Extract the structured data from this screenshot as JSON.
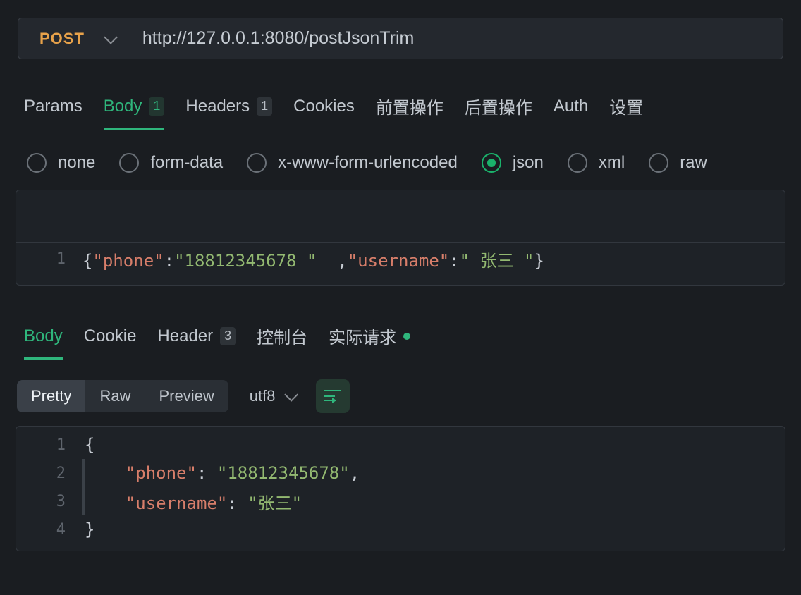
{
  "request": {
    "method": "POST",
    "url": "http://127.0.0.1:8080/postJsonTrim"
  },
  "tabs": {
    "params": "Params",
    "body": "Body",
    "body_count": "1",
    "headers": "Headers",
    "headers_count": "1",
    "cookies": "Cookies",
    "pre": "前置操作",
    "post": "后置操作",
    "auth": "Auth",
    "settings": "设置"
  },
  "body_types": {
    "none": "none",
    "form_data": "form-data",
    "xform": "x-www-form-urlencoded",
    "json": "json",
    "xml": "xml",
    "raw": "raw"
  },
  "request_body": {
    "line_no": "1",
    "tokens": {
      "brace_open": "{",
      "q1": "\"",
      "key1": "phone",
      "q2": "\"",
      "colon1": ":",
      "q3": "\"",
      "val1": "18812345678 ",
      "q4": "\"",
      "sep": "  ,",
      "q5": "\"",
      "key2": "username",
      "q6": "\"",
      "colon2": ":",
      "q7": "\"",
      "val2": " 张三 ",
      "q8": "\"",
      "brace_close": "}"
    }
  },
  "response_tabs": {
    "body": "Body",
    "cookie": "Cookie",
    "header": "Header",
    "header_count": "3",
    "console": "控制台",
    "actual": "实际请求"
  },
  "response_toolbar": {
    "pretty": "Pretty",
    "raw": "Raw",
    "preview": "Preview",
    "encoding": "utf8"
  },
  "response_body": {
    "lines": {
      "l1_no": "1",
      "l1_code_brace": "{",
      "l2_no": "2",
      "l2_indent": "    ",
      "l2_q1": "\"",
      "l2_key": "phone",
      "l2_q2": "\"",
      "l2_colon": ": ",
      "l2_q3": "\"",
      "l2_val": "18812345678",
      "l2_q4": "\"",
      "l2_comma": ",",
      "l3_no": "3",
      "l3_indent": "    ",
      "l3_q1": "\"",
      "l3_key": "username",
      "l3_q2": "\"",
      "l3_colon": ": ",
      "l3_q3": "\"",
      "l3_val": "张三",
      "l3_q4": "\"",
      "l4_no": "4",
      "l4_code_brace": "}"
    }
  }
}
